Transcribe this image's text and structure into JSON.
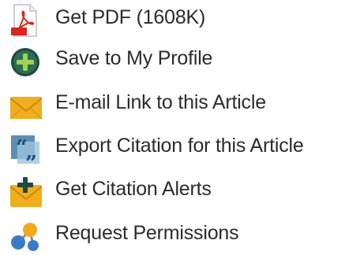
{
  "links": [
    {
      "label": "Get PDF (1608K)",
      "icon": "pdf-icon"
    },
    {
      "label": "Save to My Profile",
      "icon": "add-circle-icon"
    },
    {
      "label": "E-mail Link to this Article",
      "icon": "envelope-icon"
    },
    {
      "label": "Export Citation for this Article",
      "icon": "quote-icon"
    },
    {
      "label": "Get Citation Alerts",
      "icon": "envelope-plus-icon"
    },
    {
      "label": "Request Permissions",
      "icon": "molecule-icon"
    }
  ],
  "colors": {
    "text": "#2b2b2b",
    "pdf_red": "#d7261e",
    "green": "#3f8a4a",
    "envelope": "#f0ad1e",
    "quote_blue": "#2d6fa3",
    "molecule_blue": "#3a7cc4",
    "molecule_orange": "#f2a91b"
  }
}
